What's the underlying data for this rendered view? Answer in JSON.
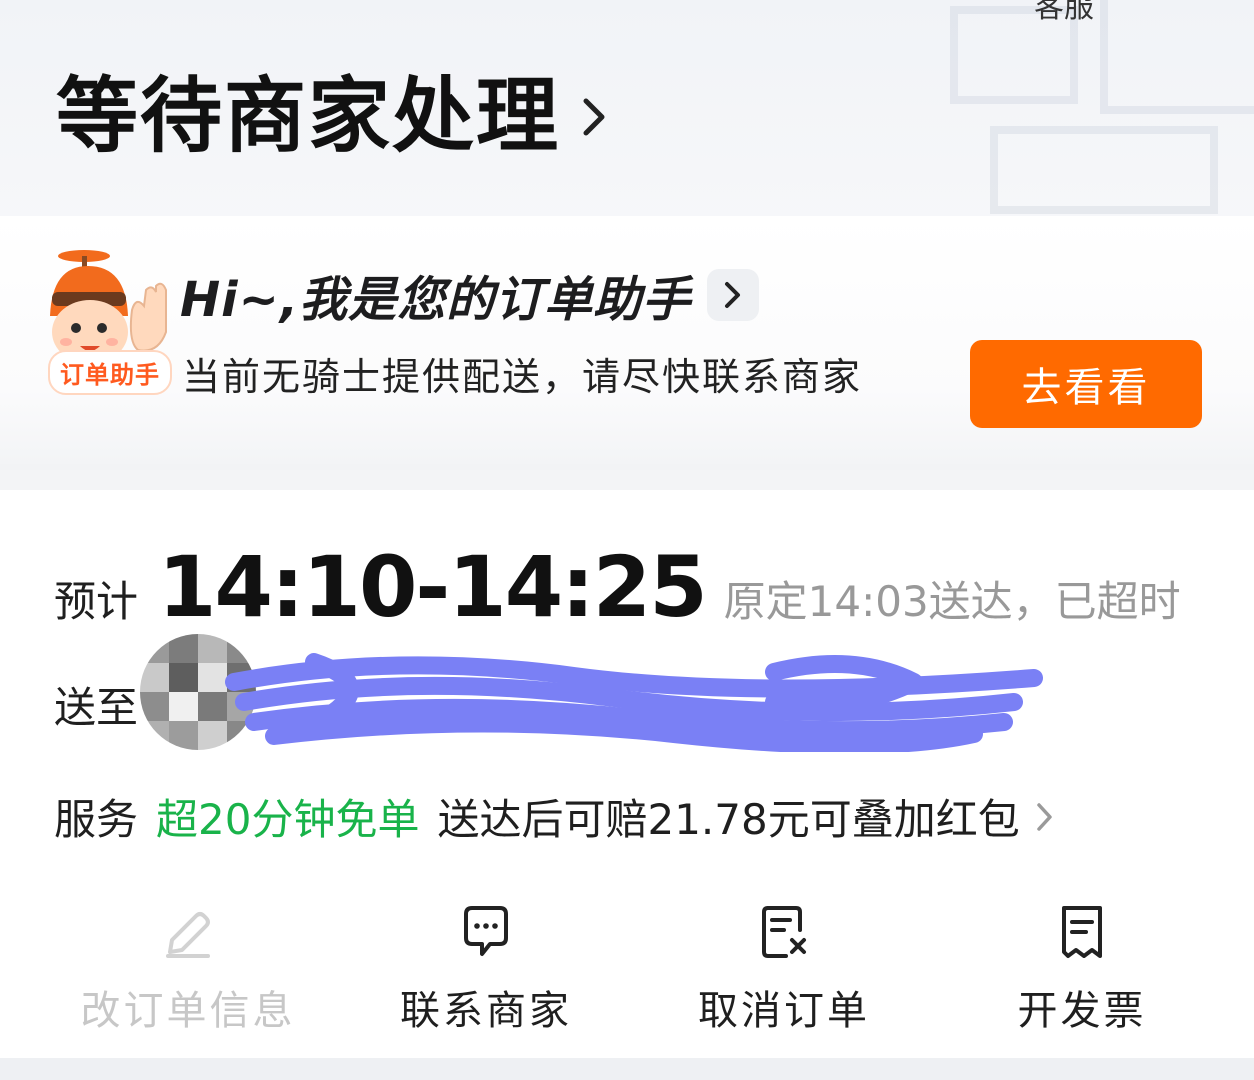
{
  "header": {
    "service_label": "客服",
    "status_title": "等待商家处理"
  },
  "assistant": {
    "title": "Hi~,我是您的订单助手",
    "badge": "订单助手",
    "message": "当前无骑士提供配送，请尽快联系商家",
    "button_label": "去看看",
    "button_color": "#ff6a00"
  },
  "delivery": {
    "eta_label": "预计",
    "eta_time": "14:10-14:25",
    "eta_note": "原定14:03送达，已超时",
    "address_label": "送至",
    "service_label": "服务",
    "service_highlight": "超20分钟免单",
    "service_detail": "送达后可赔21.78元可叠加红包",
    "highlight_color": "#19b34a"
  },
  "actions": [
    {
      "label": "改订单信息",
      "icon": "edit-icon",
      "enabled": false
    },
    {
      "label": "联系商家",
      "icon": "chat-icon",
      "enabled": true
    },
    {
      "label": "取消订单",
      "icon": "cancel-order-icon",
      "enabled": true
    },
    {
      "label": "开发票",
      "icon": "invoice-icon",
      "enabled": true
    }
  ]
}
